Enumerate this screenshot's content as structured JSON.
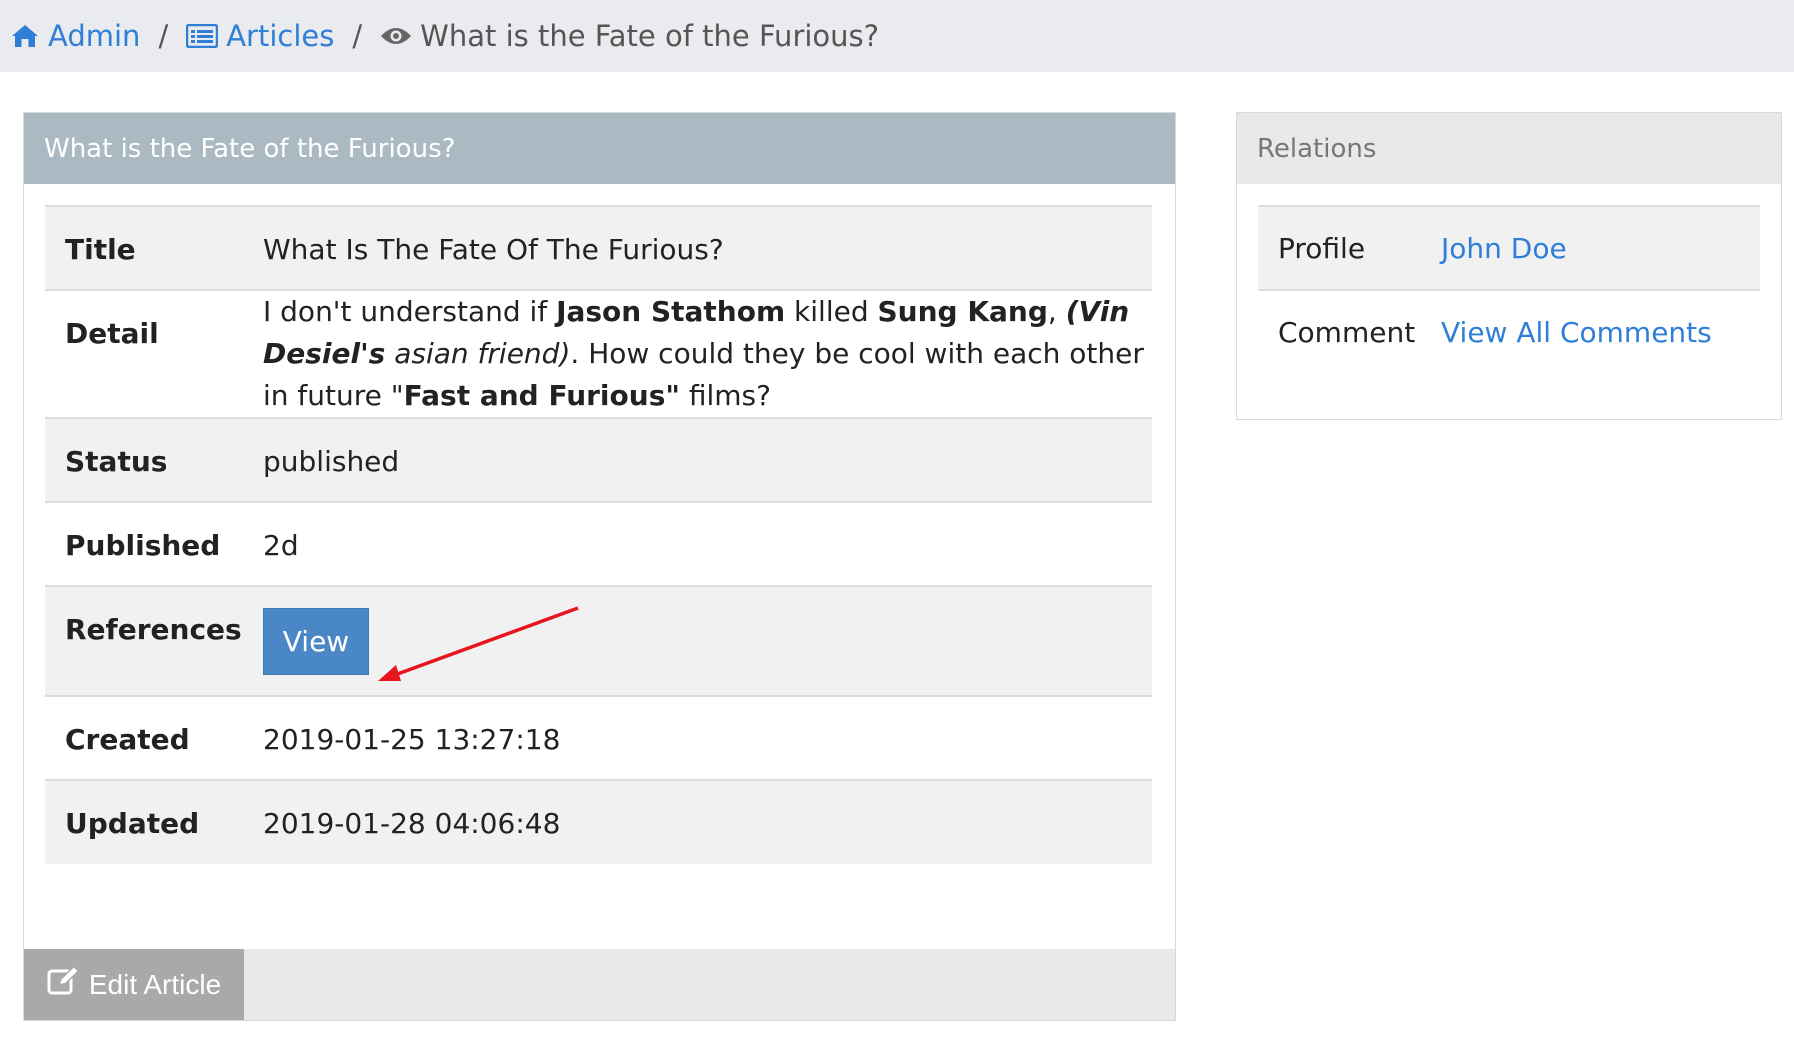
{
  "breadcrumb": {
    "home_label": "Admin",
    "section_label": "Articles",
    "current_label": "What is the Fate of the Furious?",
    "separator": "/"
  },
  "article_panel": {
    "header": "What is the Fate of the Furious?",
    "fields": {
      "title": {
        "label": "Title",
        "value": "What Is The Fate Of The Furious?"
      },
      "detail": {
        "label": "Detail",
        "parts": [
          "I don't understand if ",
          "Jason Stathom",
          " killed ",
          "Sung Kang",
          ", ",
          "(Vin Desiel's",
          " asian friend)",
          ". How could they be cool with each other in future \"",
          "Fast and Furious\"",
          " films?"
        ]
      },
      "status": {
        "label": "Status",
        "value": "published"
      },
      "published": {
        "label": "Published",
        "value": "2d"
      },
      "references": {
        "label": "References",
        "button": "View"
      },
      "created": {
        "label": "Created",
        "value": "2019-01-25 13:27:18"
      },
      "updated": {
        "label": "Updated",
        "value": "2019-01-28 04:06:48"
      }
    },
    "edit_button": "Edit Article"
  },
  "relations_panel": {
    "header": "Relations",
    "rows": [
      {
        "label": "Profile",
        "link": "John Doe"
      },
      {
        "label": "Comment",
        "link": "View All Comments"
      }
    ]
  },
  "colors": {
    "link": "#2f7fd8",
    "primary_button": "#4a87c7",
    "panel_header": "#abb9c2",
    "annotation_arrow": "#e8141e"
  },
  "icons": {
    "home": "home-icon",
    "articles": "list-icon",
    "current": "eye-icon",
    "edit": "edit-icon"
  }
}
